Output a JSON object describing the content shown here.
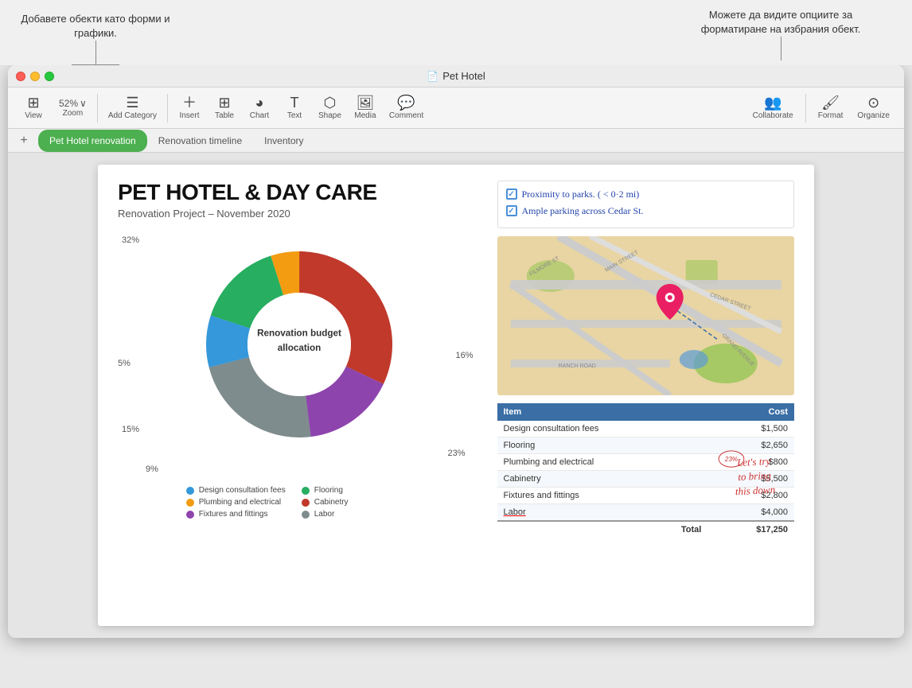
{
  "annotations": {
    "left": {
      "text": "Добавете обекти като форми и графики.",
      "line_height": 35
    },
    "right": {
      "text": "Можете да видите опциите за форматиране на избрания обект.",
      "line_height": 30
    }
  },
  "title_bar": {
    "title": "Pet Hotel",
    "doc_icon": "🟡"
  },
  "toolbar": {
    "view_label": "View",
    "zoom_value": "52%",
    "zoom_label": "Zoom",
    "add_category_label": "Add Category",
    "insert_label": "Insert",
    "table_label": "Table",
    "chart_label": "Chart",
    "text_label": "Text",
    "shape_label": "Shape",
    "media_label": "Media",
    "comment_label": "Comment",
    "collaborate_label": "Collaborate",
    "format_label": "Format",
    "organize_label": "Organize"
  },
  "tabs": [
    {
      "label": "Pet Hotel renovation",
      "active": true
    },
    {
      "label": "Renovation timeline",
      "active": false
    },
    {
      "label": "Inventory",
      "active": false
    }
  ],
  "document": {
    "title": "PET HOTEL & DAY CARE",
    "subtitle": "Renovation Project – November 2020",
    "chart": {
      "center_text": "Renovation budget allocation",
      "labels": [
        {
          "value": "32%",
          "position": "top-left"
        },
        {
          "value": "5%",
          "position": "mid-left"
        },
        {
          "value": "15%",
          "position": "bottom-left"
        },
        {
          "value": "9%",
          "position": "bottom-left-2"
        },
        {
          "value": "16%",
          "position": "mid-right"
        },
        {
          "value": "23%",
          "position": "bottom-right"
        }
      ],
      "segments": [
        {
          "color": "#c0392b",
          "label": "Cabinetry",
          "percent": 32
        },
        {
          "color": "#8e44ad",
          "label": "Fixtures and fittings",
          "percent": 16
        },
        {
          "color": "#7f8c8d",
          "label": "Labor",
          "percent": 23
        },
        {
          "color": "#3498db",
          "label": "Design consultation fees",
          "percent": 9
        },
        {
          "color": "#27ae60",
          "label": "Flooring",
          "percent": 15
        },
        {
          "color": "#f39c12",
          "label": "Plumbing and electrical",
          "percent": 5
        }
      ],
      "legend": [
        {
          "color": "#3498db",
          "label": "Design consultation fees"
        },
        {
          "color": "#f39c12",
          "label": "Plumbing and electrical"
        },
        {
          "color": "#8e44ad",
          "label": "Fixtures and fittings"
        },
        {
          "color": "#27ae60",
          "label": "Flooring"
        },
        {
          "color": "#c0392b",
          "label": "Cabinetry"
        },
        {
          "color": "#7f8c8d",
          "label": "Labor"
        }
      ]
    },
    "checks": [
      {
        "text": "Proximity to parks. ( < 0·2 mi)"
      },
      {
        "text": "Ample parking across  Cedar St."
      }
    ],
    "table": {
      "headers": [
        "Item",
        "Cost"
      ],
      "rows": [
        {
          "item": "Design consultation fees",
          "cost": "$1,500",
          "highlight": false
        },
        {
          "item": "Flooring",
          "cost": "$2,650",
          "highlight": false
        },
        {
          "item": "Plumbing and electrical",
          "cost": "$800",
          "highlight": false
        },
        {
          "item": "Cabinetry",
          "cost": "$5,500",
          "highlight": false
        },
        {
          "item": "Fixtures and fittings",
          "cost": "$2,800",
          "highlight": false
        },
        {
          "item": "Labor",
          "cost": "$4,000",
          "highlight": true
        }
      ],
      "total_label": "Total",
      "total_value": "$17,250"
    },
    "handwritten_note": "Let's try\nto bring\nthis down"
  }
}
